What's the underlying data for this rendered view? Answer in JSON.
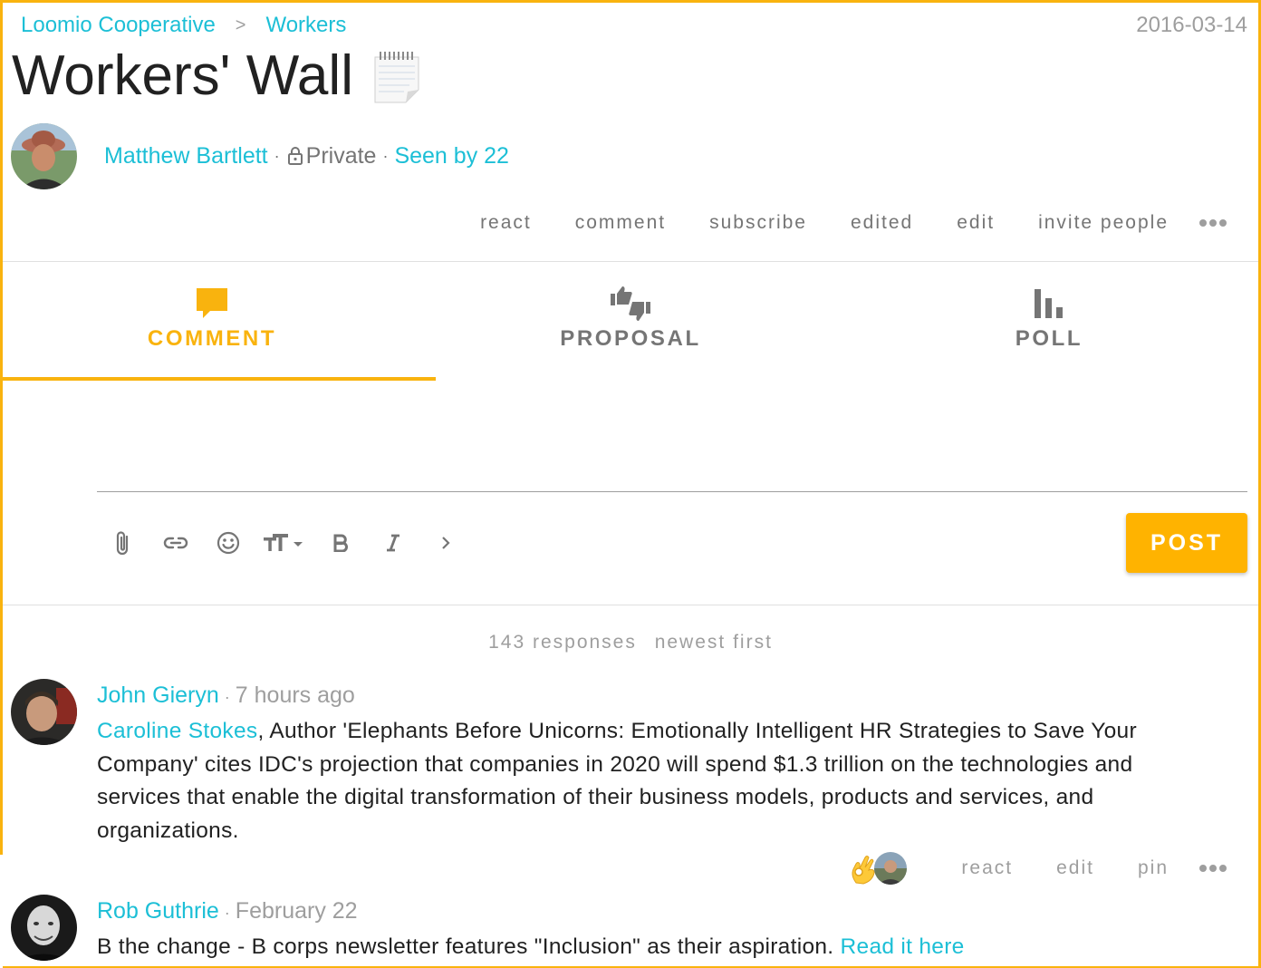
{
  "breadcrumb": {
    "group": "Loomio Cooperative",
    "separator": ">",
    "subgroup": "Workers"
  },
  "date": "2016-03-14",
  "thread": {
    "title": "Workers' Wall",
    "title_emoji_icon": "spiral-notepad-icon"
  },
  "author": {
    "name": "Matthew Bartlett",
    "privacy": "Private",
    "seen_by": "Seen by 22",
    "dot": "·"
  },
  "thread_actions": [
    "react",
    "comment",
    "subscribe",
    "edited",
    "edit",
    "invite people"
  ],
  "tabs": [
    {
      "label": "COMMENT",
      "icon": "comment-icon",
      "active": true
    },
    {
      "label": "PROPOSAL",
      "icon": "thumbs-icon",
      "active": false
    },
    {
      "label": "POLL",
      "icon": "bar-chart-icon",
      "active": false
    }
  ],
  "editor": {
    "toolbar_icons": [
      "attach-icon",
      "link-icon",
      "emoji-icon",
      "text-size-icon",
      "bold-icon",
      "italic-icon",
      "chevron-right-icon"
    ],
    "post_label": "POST"
  },
  "responses": {
    "count": "143 responses",
    "sort": "newest first"
  },
  "comments": [
    {
      "author": "John Gieryn",
      "time": "7 hours ago",
      "mention": "Caroline Stokes",
      "text": ", Author 'Elephants Before Unicorns: Emotionally Intelligent HR Strategies to Save Your Company' cites IDC's projection that companies in 2020 will spend $1.3 trillion on the technologies and services that enable the digital transformation of their business models, products and services, and organizations.",
      "actions": [
        "react",
        "edit",
        "pin"
      ],
      "reaction_icon": "ok-hand-emoji-icon"
    },
    {
      "author": "Rob Guthrie",
      "time": "February 22",
      "text": "B the change - B corps newsletter features \"Inclusion\" as their aspiration. ",
      "link": "Read it here"
    }
  ],
  "colors": {
    "accent": "#f9b30e",
    "link": "#1cbfd6",
    "muted": "#9e9e9e",
    "post_button": "#ffb300"
  }
}
